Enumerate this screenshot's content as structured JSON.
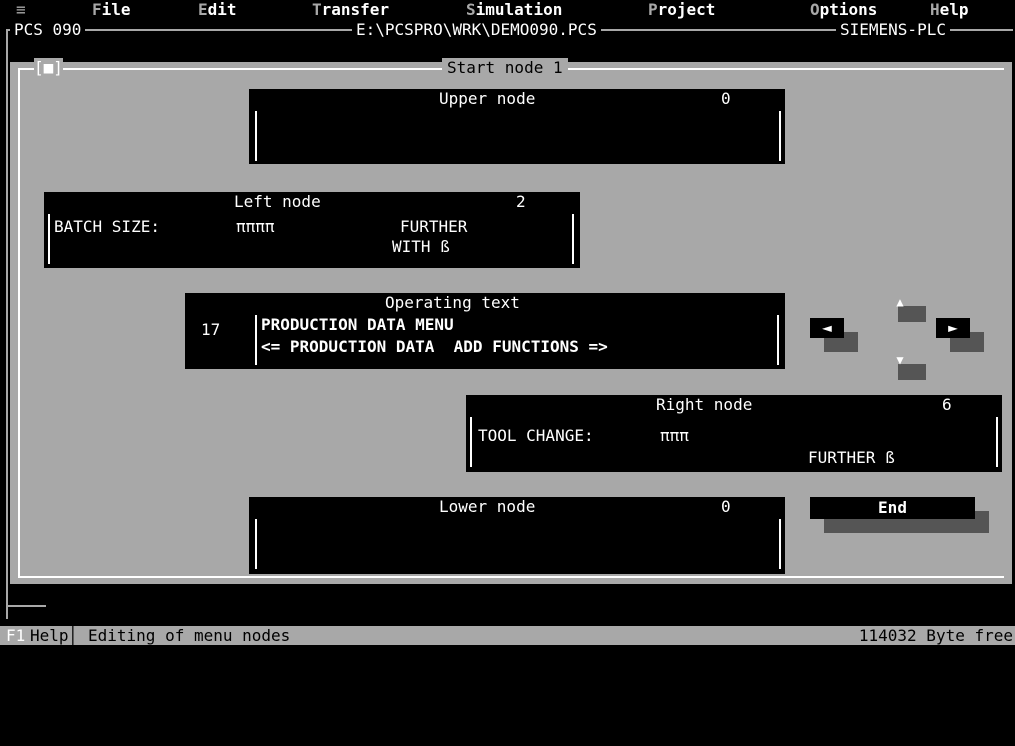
{
  "menubar": {
    "system": "≡",
    "items": [
      {
        "hot": "F",
        "rest": "ile"
      },
      {
        "hot": "E",
        "rest": "dit"
      },
      {
        "hot": "T",
        "rest": "ransfer"
      },
      {
        "hot": "S",
        "rest": "imulation"
      },
      {
        "hot": "P",
        "rest": "roject"
      },
      {
        "hot": "O",
        "rest": "ptions"
      },
      {
        "hot": "H",
        "rest": "elp"
      }
    ]
  },
  "window": {
    "left_title": "PCS 090",
    "center_title": "E:\\PCSPRO\\WRK\\DEMO090.PCS",
    "right_title": "SIEMENS-PLC"
  },
  "dialog": {
    "close": "[■]",
    "title": "Start node 1"
  },
  "upper_node": {
    "label": "Upper node",
    "value": "0"
  },
  "left_node": {
    "label": "Left node",
    "value": "2",
    "field": "BATCH SIZE:",
    "bar": "ππππ",
    "text1": "FURTHER",
    "text2": "WITH ß"
  },
  "operating": {
    "label": "Operating text",
    "number": "17",
    "line1": "PRODUCTION DATA MENU",
    "line2": "<= PRODUCTION DATA  ADD FUNCTIONS =>"
  },
  "right_node": {
    "label": "Right node",
    "value": "6",
    "field": "TOOL CHANGE:",
    "bar": "πππ",
    "text": "FURTHER ß"
  },
  "lower_node": {
    "label": "Lower node",
    "value": "0"
  },
  "nav": {
    "left": "◄",
    "right": "►",
    "up": "▲",
    "down": "▼"
  },
  "end_button": "End",
  "status": {
    "key": "F1",
    "help": "Help",
    "sep": "│",
    "message": "Editing of menu nodes",
    "free": "114032 Byte free"
  }
}
